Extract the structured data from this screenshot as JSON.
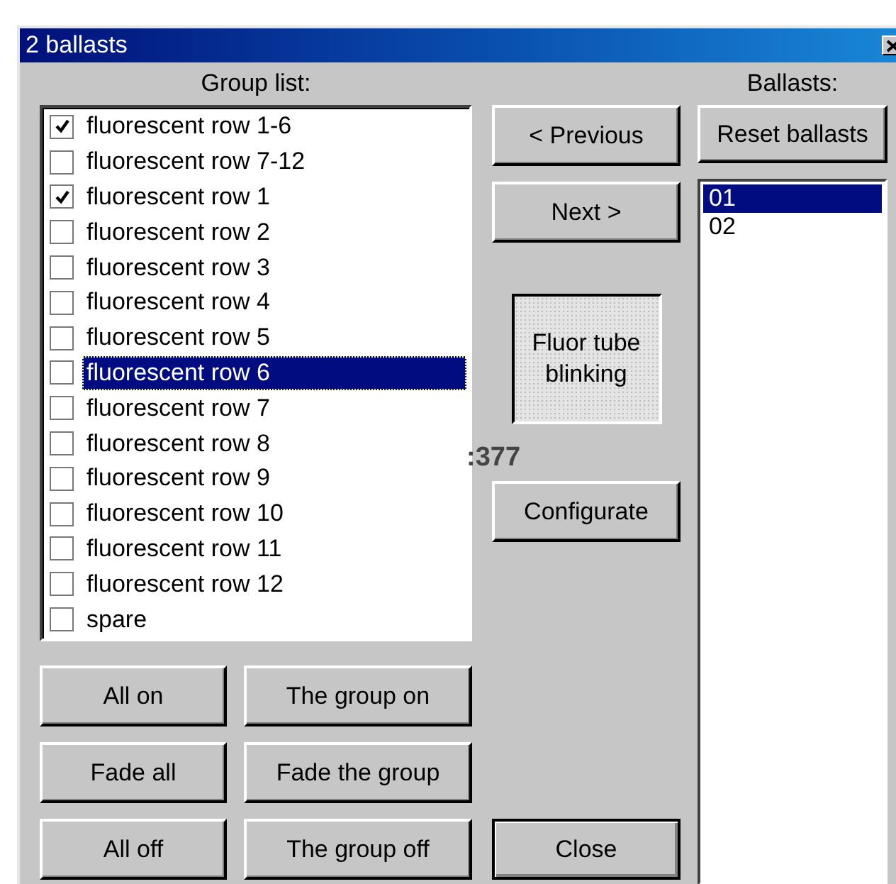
{
  "window": {
    "title": "2 ballasts"
  },
  "group_list": {
    "label": "Group list:",
    "items": [
      {
        "label": "fluorescent row 1-6",
        "checked": true,
        "selected": false
      },
      {
        "label": "fluorescent row 7-12",
        "checked": false,
        "selected": false
      },
      {
        "label": "fluorescent row 1",
        "checked": true,
        "selected": false
      },
      {
        "label": "fluorescent row 2",
        "checked": false,
        "selected": false
      },
      {
        "label": "fluorescent row 3",
        "checked": false,
        "selected": false
      },
      {
        "label": "fluorescent row 4",
        "checked": false,
        "selected": false
      },
      {
        "label": "fluorescent row 5",
        "checked": false,
        "selected": false
      },
      {
        "label": "fluorescent row 6",
        "checked": false,
        "selected": true
      },
      {
        "label": "fluorescent row 7",
        "checked": false,
        "selected": false
      },
      {
        "label": "fluorescent row 8",
        "checked": false,
        "selected": false
      },
      {
        "label": "fluorescent row 9",
        "checked": false,
        "selected": false
      },
      {
        "label": "fluorescent row 10",
        "checked": false,
        "selected": false
      },
      {
        "label": "fluorescent row 11",
        "checked": false,
        "selected": false
      },
      {
        "label": "fluorescent row 12",
        "checked": false,
        "selected": false
      },
      {
        "label": "spare",
        "checked": false,
        "selected": false
      }
    ]
  },
  "group_buttons": [
    "All on",
    "The group on",
    "Fade all",
    "Fade the group",
    "All off",
    "The group off"
  ],
  "previous_button": "< Previous",
  "next_button": "Next >",
  "status": "Fluor tube blinking",
  "count_label": ":377",
  "configurate_button": "Configurate",
  "close_button": "Close",
  "ballasts": {
    "label": "Ballasts:",
    "reset_button": "Reset ballasts",
    "items": [
      {
        "label": "01",
        "selected": true
      },
      {
        "label": "02",
        "selected": false
      }
    ]
  }
}
